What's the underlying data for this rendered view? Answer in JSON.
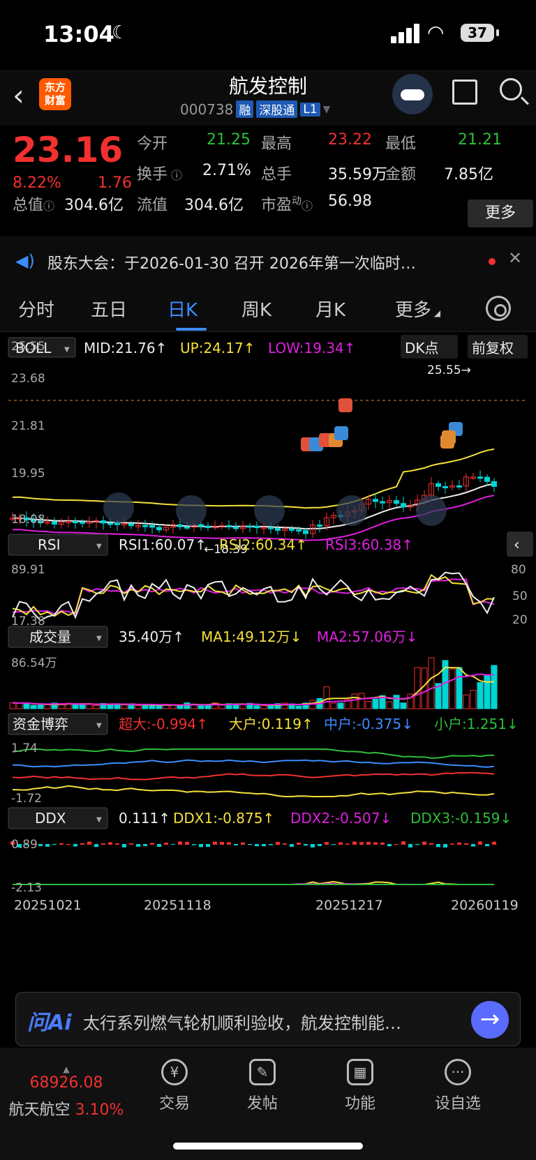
{
  "status": {
    "time": "13:04",
    "battery": "37"
  },
  "header": {
    "title": "航发控制",
    "code": "000738",
    "tags": [
      "融",
      "深股通",
      "L1"
    ],
    "logo_line1": "东方",
    "logo_line2": "财富"
  },
  "quote": {
    "price": "23.16",
    "change_pct": "8.22%",
    "change": "1.76",
    "open_label": "今开",
    "open": "21.25",
    "high_label": "最高",
    "high": "23.22",
    "low_label": "最低",
    "low": "21.21",
    "turnover_label": "换手",
    "turnover": "2.71%",
    "volume_label": "总手",
    "volume": "35.59万",
    "amount_label": "金额",
    "amount": "7.85亿",
    "mktcap_label": "总值",
    "mktcap": "304.6亿",
    "float_label": "流值",
    "float": "304.6亿",
    "pe_label": "市盈",
    "pe_sup": "动",
    "pe": "56.98",
    "more": "更多"
  },
  "notice": {
    "text": "股东大会：于2026-01-30 召开 2026年第一次临时…"
  },
  "tabs": {
    "items": [
      "分时",
      "五日",
      "日K",
      "周K",
      "月K",
      "更多"
    ],
    "active": "日K"
  },
  "chart": {
    "boll": {
      "name": "BOLL",
      "mid": "MID:21.76↑",
      "up": "UP:24.17↑",
      "low": "LOW:19.34↑",
      "dk": "DK点",
      "fq": "前复权",
      "yticks": [
        "25.55",
        "23.68",
        "21.81",
        "19.95",
        "18.08"
      ],
      "max_label": "25.55→",
      "min_label": "←18.39"
    },
    "rsi": {
      "name": "RSI",
      "rsi1": "RSI1:60.07↑",
      "rsi2": "RSI2:60.34↑",
      "rsi3": "RSI3:60.38↑",
      "top": "89.91",
      "bottom": "17.38",
      "r80": "80",
      "r50": "50",
      "r20": "20"
    },
    "vol": {
      "name": "成交量",
      "val": "35.40万↑",
      "ma1": "MA1:49.12万↓",
      "ma2": "MA2:57.06万↓",
      "top": "86.54万"
    },
    "fund": {
      "name": "资金博弈",
      "super": "超大:-0.994↑",
      "big": "大户:0.119↑",
      "mid": "中户:-0.375↓",
      "small": "小户:1.251↓",
      "top": "1.74",
      "bottom": "-1.72"
    },
    "ddx": {
      "name": "DDX",
      "val": "0.111↑",
      "ddx1": "DDX1:-0.875↑",
      "ddx2": "DDX2:-0.507↓",
      "ddx3": "DDX3:-0.159↓",
      "top": "0.89",
      "bottom": "-2.13"
    },
    "dates": [
      "20251021",
      "20251118",
      "20251217",
      "20260119"
    ],
    "markers": [
      "B",
      "S",
      "B",
      "T",
      "S",
      "B",
      "T",
      "S",
      "T"
    ]
  },
  "ai": {
    "logo": "问Ai",
    "text": "太行系列燃气轮机顺利验收，航发控制能…"
  },
  "bottom_nav": {
    "index_value": "68926.08",
    "index_name": "航天航空",
    "index_pct": "3.10%",
    "items": [
      "交易",
      "发帖",
      "功能",
      "设自选"
    ]
  },
  "colors": {
    "up": "#f23030",
    "down": "#00d4d4",
    "accent": "#3b8cff",
    "yellow": "#f5e13a",
    "magenta": "#e020e0"
  }
}
